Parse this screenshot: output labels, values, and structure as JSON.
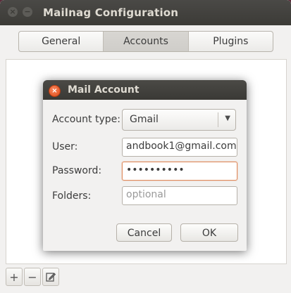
{
  "main_window": {
    "title": "Mailnag Configuration",
    "close_glyph": "×",
    "minimize_glyph": "−"
  },
  "tabs": [
    {
      "label": "General",
      "active": false
    },
    {
      "label": "Accounts",
      "active": true
    },
    {
      "label": "Plugins",
      "active": false
    }
  ],
  "toolbar": {
    "add_glyph": "+",
    "remove_glyph": "−",
    "edit_icon": "edit-icon"
  },
  "dialog": {
    "title": "Mail Account",
    "close_glyph": "×",
    "account_type": {
      "label": "Account type:",
      "value": "Gmail"
    },
    "user": {
      "label": "User:",
      "value": "andbook1@gmail.com"
    },
    "password": {
      "label": "Password:",
      "value": "••••••••••"
    },
    "folders": {
      "label": "Folders:",
      "placeholder": "optional"
    },
    "cancel_label": "Cancel",
    "ok_label": "OK"
  },
  "colors": {
    "titlebar": "#3c3b37",
    "close_button": "#df4a16",
    "focus_border": "#e08e62",
    "window_bg": "#f2f1f0"
  }
}
